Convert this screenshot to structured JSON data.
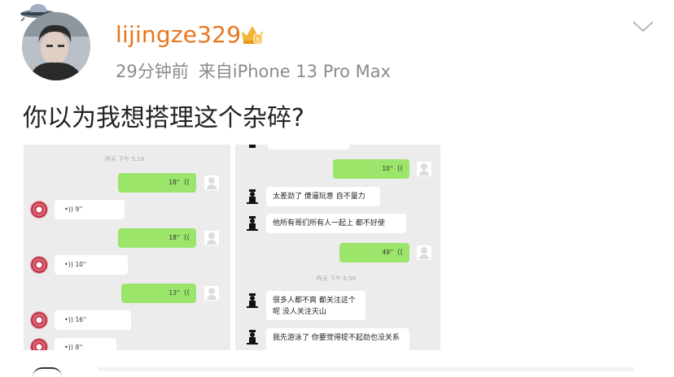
{
  "user": {
    "name": "lijingze329",
    "time_ago": "29分钟前",
    "source": "来自iPhone 13 Pro Max"
  },
  "post": {
    "text": "你以为我想搭理这个杂碎?"
  },
  "chat_left": {
    "timestamp": "昨天 下午 5:19",
    "items": [
      {
        "from": "me",
        "duration": "18''"
      },
      {
        "from": "other",
        "duration": "9''"
      },
      {
        "from": "me",
        "duration": "18''"
      },
      {
        "from": "other",
        "duration": "10''"
      },
      {
        "from": "me",
        "duration": "13''"
      },
      {
        "from": "other",
        "duration": "16''"
      },
      {
        "from": "other",
        "duration": "8''"
      }
    ]
  },
  "chat_right": {
    "voice_top": "10''",
    "msg1": "太差劲了 傻逼玩意 自不量力",
    "msg2": "他所有哥们所有人一起上 都不好使",
    "voice_mid": "49''",
    "timestamp": "昨天 下午 6:58",
    "msg3": "很多人都不爽 都关注这个呢 没人关注天山",
    "msg4": "我先游泳了 你要觉得提不起劲也没关系"
  },
  "icons": {
    "crown": "vip-crown-icon",
    "chevron": "chevron-down-icon"
  },
  "colors": {
    "username": "#e8761f",
    "meta": "#8a8a8a",
    "wechat_green": "#9be56b"
  }
}
